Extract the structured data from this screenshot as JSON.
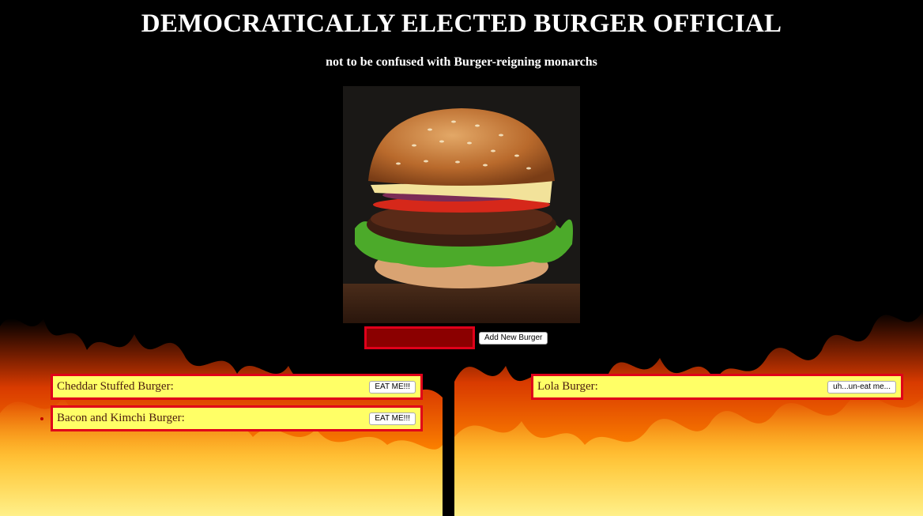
{
  "header": {
    "title": "DEMOCRATICALLY ELECTED BURGER OFFICIAL",
    "subtitle": "not to be confused with Burger-reigning monarchs"
  },
  "hero_image": {
    "icon": "burger-photo"
  },
  "form": {
    "input_value": "",
    "submit_label": "Add New Burger"
  },
  "uneaten": [
    {
      "name": "Cheddar Stuffed Burger:",
      "action": "EAT ME!!!"
    },
    {
      "name": "Bacon and Kimchi Burger:",
      "action": "EAT ME!!!"
    }
  ],
  "eaten": [
    {
      "name": "Lola Burger:",
      "action": "uh...un-eat me..."
    }
  ],
  "colors": {
    "background": "#000000",
    "item_fill": "#ffff66",
    "item_border": "#e0001a",
    "input_fill": "#8b0000",
    "fire": "#ff6a00"
  }
}
